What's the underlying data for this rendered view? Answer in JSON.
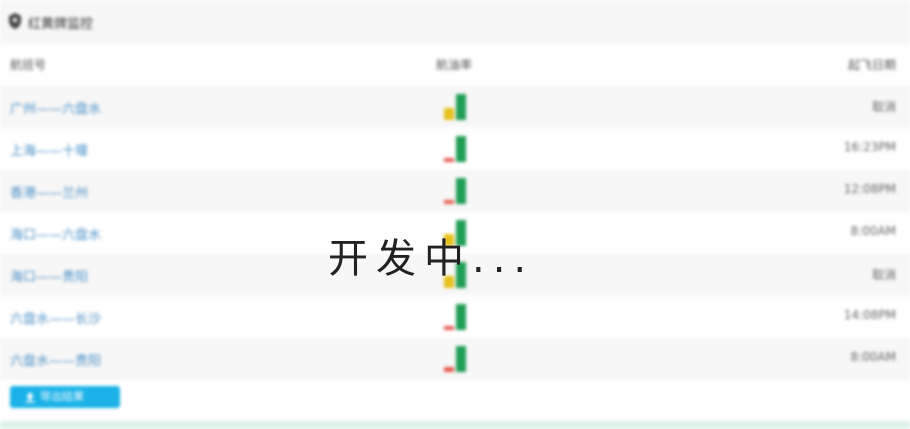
{
  "header": {
    "title": "红黄牌监控",
    "icon": "alert-shield-icon"
  },
  "columns": {
    "flight": "航班号",
    "rate": "航油率",
    "date": "起飞日期"
  },
  "rows": [
    {
      "route": "广州——六盘水",
      "time": "取消",
      "alt": true,
      "bars": [
        {
          "color": "#e8c11a",
          "value": 0.45
        },
        {
          "color": "#1f9d55",
          "value": 1.0
        }
      ]
    },
    {
      "route": "上海——十堰",
      "time": "16:23PM",
      "alt": false,
      "bars": [
        {
          "color": "#e85a4f",
          "value": 0.15
        },
        {
          "color": "#1f9d55",
          "value": 1.0
        }
      ]
    },
    {
      "route": "香港——兰州",
      "time": "12:08PM",
      "alt": true,
      "bars": [
        {
          "color": "#e85a4f",
          "value": 0.15
        },
        {
          "color": "#1f9d55",
          "value": 1.0
        }
      ]
    },
    {
      "route": "海口——六盘水",
      "time": "8:00AM",
      "alt": false,
      "bars": [
        {
          "color": "#e8c11a",
          "value": 0.45
        },
        {
          "color": "#1f9d55",
          "value": 1.0
        }
      ]
    },
    {
      "route": "海口——贵阳",
      "time": "取消",
      "alt": true,
      "bars": [
        {
          "color": "#e8c11a",
          "value": 0.45
        },
        {
          "color": "#1f9d55",
          "value": 1.0
        }
      ]
    },
    {
      "route": "六盘水——长沙",
      "time": "14:08PM",
      "alt": false,
      "bars": [
        {
          "color": "#e85a4f",
          "value": 0.15
        },
        {
          "color": "#1f9d55",
          "value": 1.0
        }
      ]
    },
    {
      "route": "六盘水——贵阳",
      "time": "8:00AM",
      "alt": true,
      "bars": [
        {
          "color": "#e85a4f",
          "value": 0.2
        },
        {
          "color": "#1f9d55",
          "value": 1.0
        }
      ]
    }
  ],
  "footer": {
    "export_label": "导出结果",
    "export_icon": "upload-icon"
  },
  "overlay": {
    "text": "开发中..."
  },
  "colors": {
    "link": "#4a8fc7",
    "button": "#1ab2e8"
  }
}
